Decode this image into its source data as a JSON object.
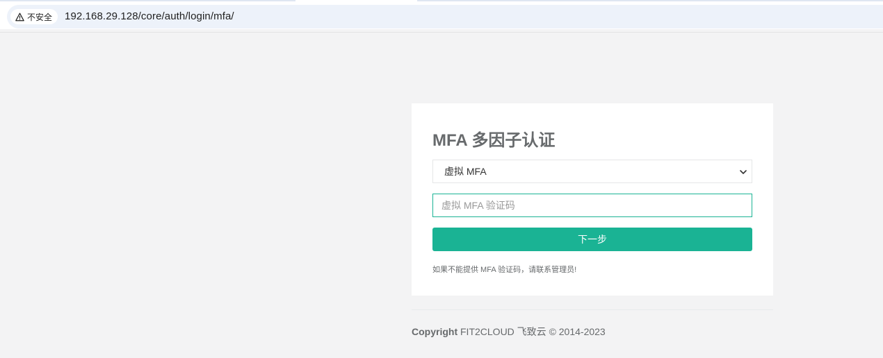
{
  "browser": {
    "security_label": "不安全",
    "url": "192.168.29.128/core/auth/login/mfa/"
  },
  "login": {
    "title": "MFA 多因子认证",
    "mfa_select": {
      "selected": "虚拟 MFA",
      "options": [
        "虚拟 MFA"
      ]
    },
    "code_input": {
      "placeholder": "虚拟 MFA 验证码",
      "value": ""
    },
    "next_button": "下一步",
    "help_text": "如果不能提供 MFA 验证码，请联系管理员!"
  },
  "footer": {
    "copyright_label": "Copyright",
    "copyright_text": " FIT2CLOUD 飞致云 © 2014-2023"
  },
  "colors": {
    "accent": "#1ab394",
    "page_bg": "#f3f3f4",
    "text": "#676a6c"
  },
  "icons": {
    "security": "warning-triangle-icon",
    "select": "chevron-down-icon"
  }
}
